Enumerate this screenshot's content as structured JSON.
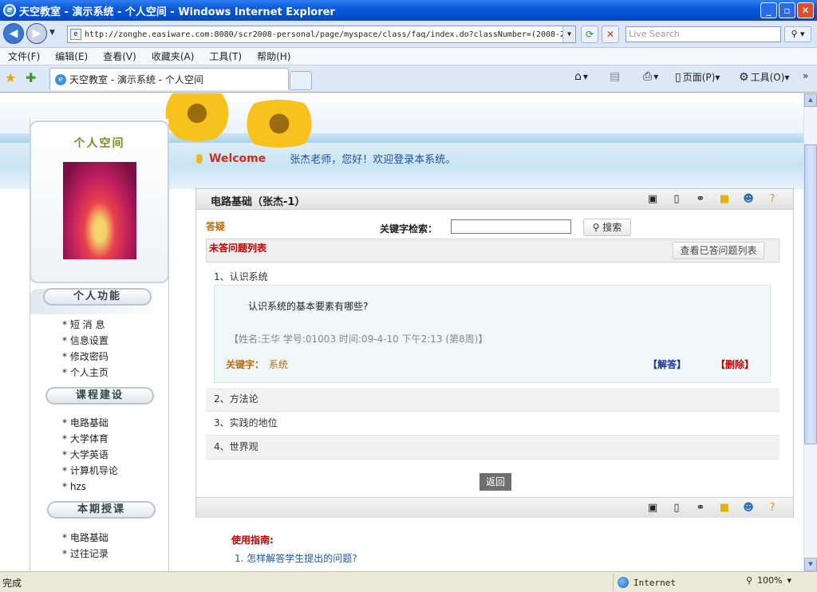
{
  "window": {
    "title": "天空教室 - 演示系统 - 个人空间 - Windows Internet Explorer",
    "ie_logo": "e",
    "buttons": {
      "min": "_",
      "max": "▫",
      "close": "✕"
    }
  },
  "address_bar": {
    "back": "◀",
    "forward": "▶",
    "url": "http://zonghe.easiware.com:8080/scr2008-personal/page/myspace/class/faq/index.do?classNumber=(2008-2",
    "search_placeholder": "Live Search"
  },
  "menu": [
    "文件(F)",
    "编辑(E)",
    "查看(V)",
    "收藏夹(A)",
    "工具(T)",
    "帮助(H)"
  ],
  "tabs": {
    "active_label": "天空教室 - 演示系统 - 个人空间"
  },
  "command_bar": {
    "page": "页面(P)",
    "tools": "工具(O)"
  },
  "page": {
    "welcome_word": "Welcome",
    "welcome_message": "张杰老师，您好！欢迎登录本系统。",
    "sidebar": {
      "profile_title": "个人空间",
      "sections": [
        {
          "title": "个人功能",
          "items": [
            "短  消  息",
            "信息设置",
            "修改密码",
            "个人主页"
          ]
        },
        {
          "title": "课程建设",
          "items": [
            "电路基础",
            "大学体育",
            "大学英语",
            "计算机导论",
            "hzs"
          ]
        },
        {
          "title": "本期授课",
          "items": [
            "电路基础",
            "过往记录"
          ]
        }
      ]
    },
    "panel": {
      "title": "电路基础（张杰-1）",
      "section_label": "答疑",
      "keyword_label": "关键字检索：",
      "keyword_value": "",
      "search_button": "搜索",
      "list_title": "未答问题列表",
      "view_answered_button": "查看已答问题列表",
      "questions": [
        {
          "label": "1、认识系统"
        },
        {
          "label": "2、方法论"
        },
        {
          "label": "3、实践的地位"
        },
        {
          "label": "4、世界观"
        }
      ],
      "detail": {
        "question_text": "认识系统的基本要素有哪些?",
        "meta": "【姓名:王华 学号:01003 时间:09-4-10 下午2:13 (第8周)】",
        "keyword_label": "关键字：",
        "keyword_value": "系统",
        "answer_link": "【解答】",
        "delete_link": "【删除】"
      },
      "back_button": "返回"
    },
    "guide": {
      "title": "使用指南:",
      "items": [
        "1. 怎样解答学生提出的问题?"
      ]
    }
  },
  "status_bar": {
    "text": "完成",
    "zone": "Internet",
    "zoom": "100%"
  },
  "colors": {
    "title_bar": "#0a5ad9",
    "welcome": "#c4311c",
    "link_blue": "#1b57a5",
    "alert_red": "#c40000",
    "orange_label": "#c06a0c"
  }
}
